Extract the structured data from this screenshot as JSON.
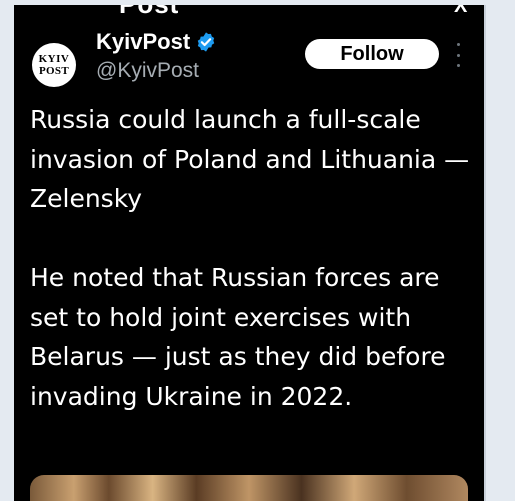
{
  "tweet": {
    "account_name": "KyivPost",
    "handle": "@KyivPost",
    "avatar_line1": "KYIV",
    "avatar_line2": "POST",
    "follow_label": "Follow",
    "header_partial": "Post",
    "close_partial": "X",
    "headline": "Russia could launch a full-scale invasion of Poland and Lithuania — Zelensky",
    "body": "He noted that Russian forces are set to hold joint exercises with Belarus — just as they did before invading Ukraine in 2022."
  },
  "icons": {
    "verified": "verified-badge-icon",
    "more": "more-options-icon"
  },
  "colors": {
    "background": "#000000",
    "verified": "#1d9bf0",
    "handle": "#a6adb3",
    "page": "#e4eaf1"
  }
}
